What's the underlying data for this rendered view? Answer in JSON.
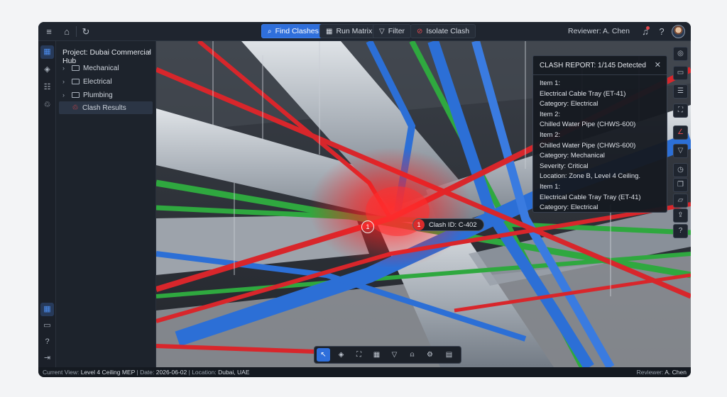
{
  "topbar": {
    "buttons": {
      "find_clashes": "Find Clashes",
      "run_matrix": "Run Matrix",
      "filter": "Filter",
      "isolate_clash": "Isolate Clash"
    },
    "reviewer": "Reviewer: A. Chen"
  },
  "tree": {
    "title": "Project: Dubai Commercial Hub",
    "items": [
      {
        "label": "Mechanical"
      },
      {
        "label": "Electrical"
      },
      {
        "label": "Plumbing"
      },
      {
        "label": "Clash Results"
      }
    ]
  },
  "viewport": {
    "markers": {
      "small": "1",
      "chip_num": "1",
      "chip_label": "Clash ID: C-402"
    }
  },
  "report": {
    "title": "CLASH REPORT: 1/145 Detected",
    "lines": [
      "Item 1:",
      "Electrical Cable Tray (ET-41)",
      "Category: Electrical",
      "Item 2:",
      "Chilled Water Pipe (CHWS-600)",
      "Item 2:",
      "Chilled Water Pipe (CHWS-600)",
      "Category: Mechanical",
      "Severity: Critical",
      "Location: Zone B, Level 4 Ceiling.",
      "Item 1:",
      "Electrical Cable Tray Tray (ET-41)",
      "Category: Electrical"
    ]
  },
  "status": {
    "view_label": "Current View:",
    "view_value": "Level 4 Ceiling MEP",
    "date_label": "Date:",
    "date_value": "2026-06-02",
    "location_label": "Location:",
    "location_value": "Dubai, UAE",
    "reviewer_label": "Reviewer:",
    "reviewer_value": "A. Chen"
  },
  "colors": {
    "accent": "#2f6fdb",
    "clash": "#e5484d",
    "pipe_blue": "#2c6fd6",
    "pipe_green": "#2fa83f",
    "pipe_red": "#d8262b"
  }
}
